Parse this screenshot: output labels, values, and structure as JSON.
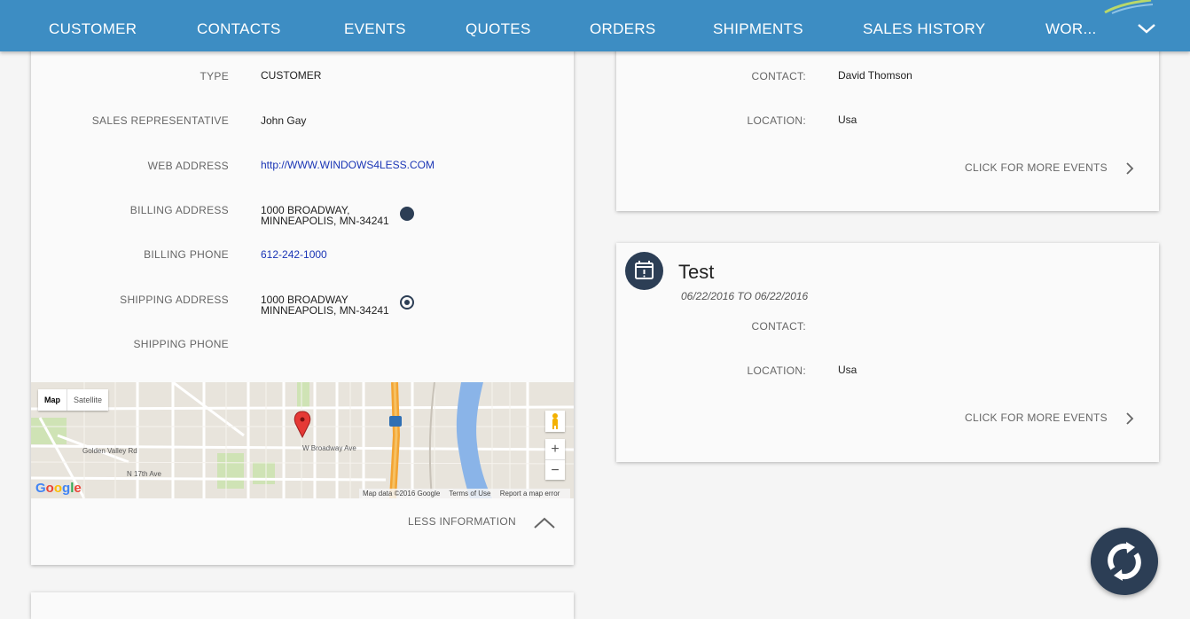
{
  "nav": {
    "tabs": [
      {
        "label": "CUSTOMER"
      },
      {
        "label": "CONTACTS"
      },
      {
        "label": "EVENTS"
      },
      {
        "label": "QUOTES"
      },
      {
        "label": "ORDERS"
      },
      {
        "label": "SHIPMENTS"
      },
      {
        "label": "SALES HISTORY"
      },
      {
        "label": "WOR..."
      }
    ],
    "more_icon": "chevron-down-icon",
    "bg_color": "#3d8dc3"
  },
  "customer": {
    "type_label": "TYPE",
    "type_value": "CUSTOMER",
    "sales_rep_label": "SALES REPRESENTATIVE",
    "sales_rep_value": "John Gay",
    "web_label": "WEB ADDRESS",
    "web_value": "http://WWW.WINDOWS4LESS.COM",
    "billing_address_label": "BILLING ADDRESS",
    "billing_address_line1": "1000 BROADWAY,",
    "billing_address_line2": "MINNEAPOLIS, MN-34241",
    "billing_phone_label": "BILLING PHONE",
    "billing_phone_value": "612-242-1000",
    "shipping_address_label": "SHIPPING ADDRESS",
    "shipping_address_line1": "1000 BROADWAY",
    "shipping_address_line2": "MINNEAPOLIS, MN-34241",
    "shipping_phone_label": "SHIPPING PHONE",
    "less_info": "LESS INFORMATION"
  },
  "map": {
    "type_map": "Map",
    "type_satellite": "Satellite",
    "zoom_in": "+",
    "zoom_out": "−",
    "logo": "Google",
    "footer_data": "Map data ©2016 Google",
    "footer_terms": "Terms of Use",
    "footer_report": "Report a map error",
    "street_main": "W Broadway Ave"
  },
  "events": [
    {
      "contact_label": "CONTACT:",
      "contact_value": "David Thomson",
      "location_label": "LOCATION:",
      "location_value": "Usa",
      "more": "CLICK FOR MORE EVENTS"
    },
    {
      "icon": "calendar-alert-icon",
      "title": "Test",
      "date": "06/22/2016 TO 06/22/2016",
      "contact_label": "CONTACT:",
      "contact_value": "",
      "location_label": "LOCATION:",
      "location_value": "Usa",
      "more": "CLICK FOR MORE EVENTS"
    }
  ],
  "fab": {
    "icon": "refresh-icon"
  },
  "colors": {
    "accent": "#3d8dc3",
    "dark": "#2c3e55",
    "link": "#1a35b5"
  }
}
